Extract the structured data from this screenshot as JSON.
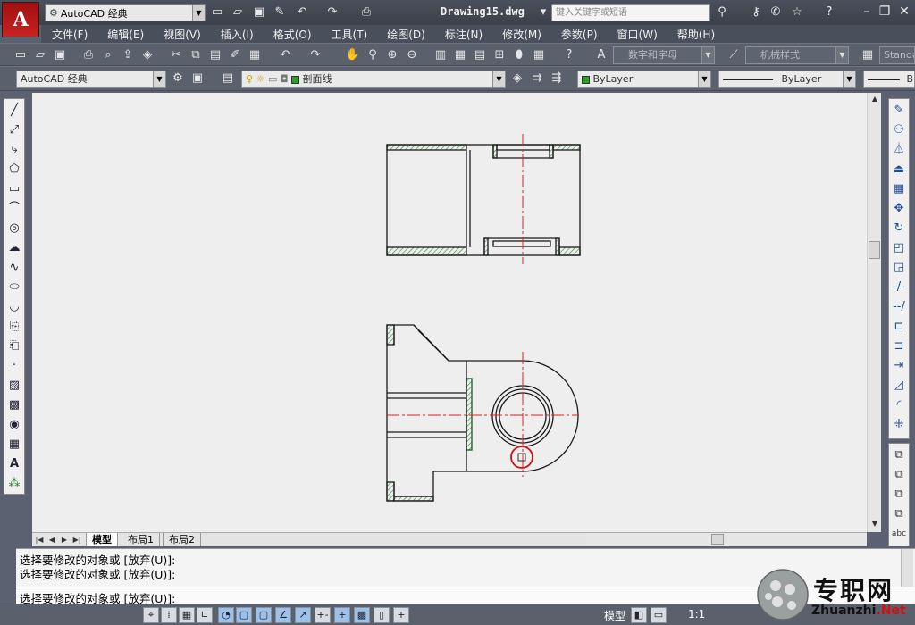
{
  "app": {
    "logo_letter": "A",
    "workspace": "AutoCAD 经典",
    "document_title": "Drawing15.dwg",
    "search_placeholder": "键入关键字或短语"
  },
  "menu": [
    "文件(F)",
    "编辑(E)",
    "视图(V)",
    "插入(I)",
    "格式(O)",
    "工具(T)",
    "绘图(D)",
    "标注(N)",
    "修改(M)",
    "参数(P)",
    "窗口(W)",
    "帮助(H)"
  ],
  "toolbar": {
    "text_style": "数字和字母",
    "dim_style": "机械样式",
    "table_style": "Standa",
    "workspace_combo": "AutoCAD 经典",
    "layer_name": "剖面线",
    "color": "ByLayer",
    "linetype": "ByLayer",
    "lineweight_partial": "B"
  },
  "layout_tabs": [
    "模型",
    "布局1",
    "布局2"
  ],
  "command": {
    "lines": [
      "选择要修改的对象或 [放弃(U)]:",
      "选择要修改的对象或 [放弃(U)]:"
    ],
    "prompt": "选择要修改的对象或 [放弃(U)]:"
  },
  "status": {
    "model": "模型",
    "scale": "1:1"
  },
  "watermark": {
    "cn": "专职网",
    "url_prefix": "Zhuanzhi",
    "url_suffix": ".Net"
  },
  "colors": {
    "hatch": "#2e8b2e",
    "centerline": "#e02020",
    "selection": "#d01010"
  }
}
